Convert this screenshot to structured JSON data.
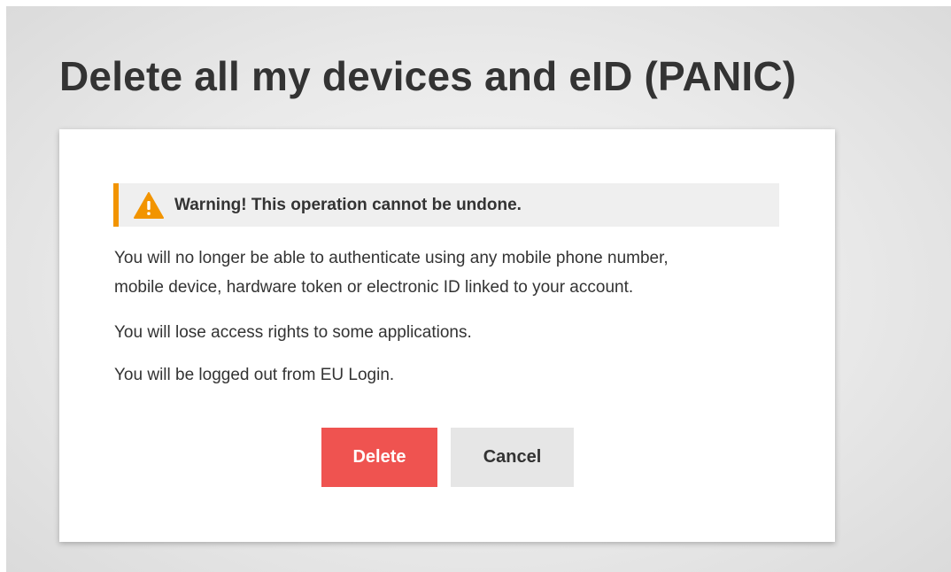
{
  "page": {
    "title": "Delete all my devices and eID (PANIC)"
  },
  "warning": {
    "icon": "warning-triangle-icon",
    "text": "Warning! This operation cannot be undone.",
    "accent_color": "#f29400"
  },
  "messages": {
    "line_1": "You will no longer be able to authenticate using any mobile phone number,",
    "line_2": "mobile device, hardware token or electronic ID linked to your account.",
    "access_rights": "You will lose access rights to some applications.",
    "logout": "You will be logged out from EU Login."
  },
  "actions": {
    "delete_label": "Delete",
    "cancel_label": "Cancel",
    "delete_color": "#ef5350"
  }
}
